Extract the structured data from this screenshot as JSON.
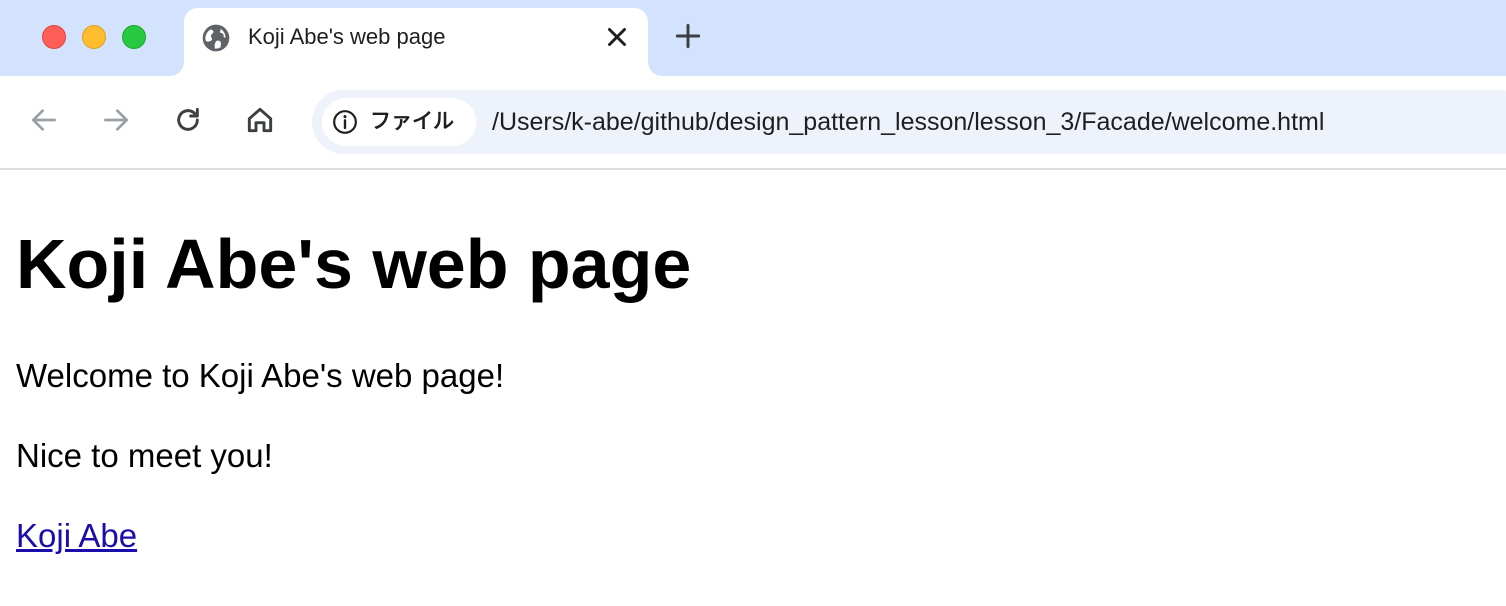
{
  "browser": {
    "tab": {
      "title": "Koji Abe's web page",
      "favicon": "globe-icon"
    },
    "toolbar": {
      "icons": [
        "back-arrow-icon",
        "forward-arrow-icon",
        "reload-icon",
        "home-icon"
      ]
    },
    "omnibox": {
      "site_chip_label": "ファイル",
      "url": "/Users/k-abe/github/design_pattern_lesson/lesson_3/Facade/welcome.html"
    },
    "colors": {
      "tabstrip": "#d3e3fd",
      "omnibox": "#eef2fb",
      "link": "#1a0dab"
    }
  },
  "page": {
    "heading": "Koji Abe's web page",
    "paragraphs": [
      "Welcome to Koji Abe's web page!",
      "Nice to meet you!"
    ],
    "link_text": "Koji Abe"
  }
}
